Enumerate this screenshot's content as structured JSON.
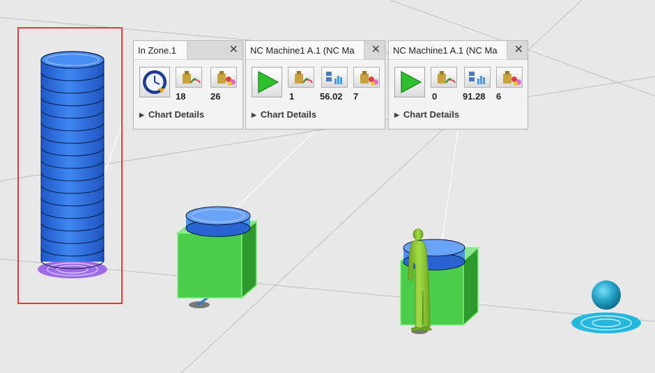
{
  "panels": [
    {
      "title": "In Zone.1",
      "value_1": "18",
      "value_2": "26",
      "details_label": "Chart Details",
      "main_icon": "clock-icon"
    },
    {
      "title": "NC Machine1 A.1 (NC Ma",
      "value_1": "1",
      "value_2": "56.02",
      "value_3": "7",
      "details_label": "Chart Details",
      "main_icon": "play-icon"
    },
    {
      "title": "NC Machine1 A.1 (NC Ma",
      "value_1": "0",
      "value_2": "91.28",
      "value_3": "6",
      "details_label": "Chart Details",
      "main_icon": "play-icon"
    }
  ],
  "colors": {
    "selection_box": "#e03a3a",
    "stack_blue": "#2f6fdc",
    "machine_green": "#4ccc4c",
    "operator_green": "#8fcc3a",
    "sink_cyan": "#26b8dc",
    "floor_pad_purple": "#9f6ce8",
    "play_green": "#2fc02f"
  },
  "icons": [
    "close-icon",
    "weight-gauge-icon",
    "parts-icon",
    "stats-icon",
    "clock-icon",
    "play-icon"
  ]
}
